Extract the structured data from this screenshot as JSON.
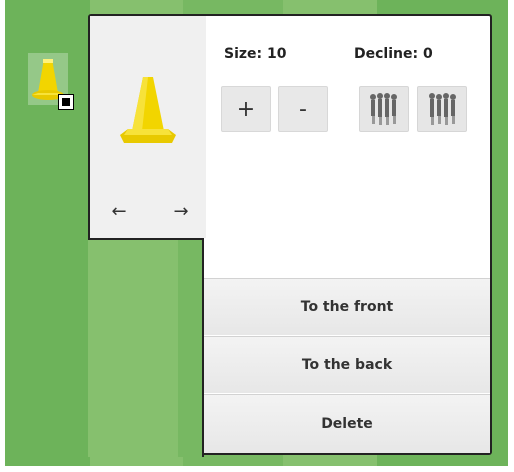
{
  "controls": {
    "size_label": "Size: 10",
    "decline_label": "Decline: 0",
    "plus": "+",
    "minus": "-",
    "arrow_left": "←",
    "arrow_right": "→"
  },
  "menu": {
    "front": "To the front",
    "back": "To the back",
    "delete": "Delete"
  },
  "colors": {
    "cone": "#f2d500",
    "field_dark": "#6db35a",
    "field_light": "#86c06e"
  }
}
